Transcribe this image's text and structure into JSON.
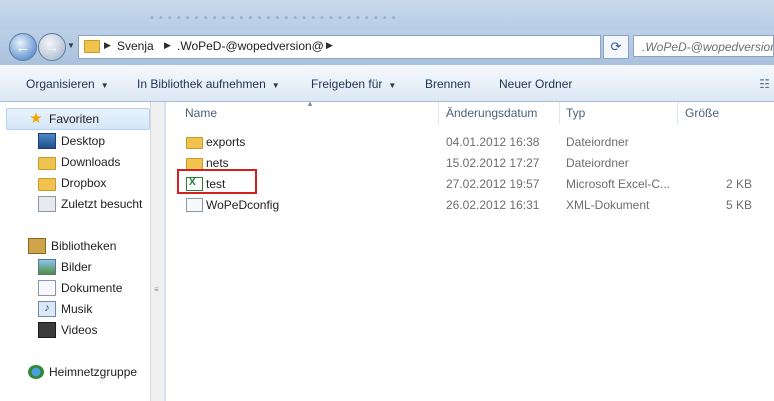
{
  "address": {
    "crumbs": [
      "Svenja",
      ".WoPeD-@wopedversion@"
    ],
    "search_text": ".WoPeD-@wopedversion@"
  },
  "toolbar": {
    "organise": "Organisieren",
    "include_library": "In Bibliothek aufnehmen",
    "share": "Freigeben für",
    "burn": "Brennen",
    "new_folder": "Neuer Ordner"
  },
  "nav": {
    "favorites": "Favoriten",
    "desktop": "Desktop",
    "downloads": "Downloads",
    "dropbox": "Dropbox",
    "recent": "Zuletzt besucht",
    "libraries": "Bibliotheken",
    "pictures": "Bilder",
    "documents": "Dokumente",
    "music": "Musik",
    "videos": "Videos",
    "homegroup": "Heimnetzgruppe"
  },
  "columns": {
    "name": "Name",
    "date": "Änderungsdatum",
    "type": "Typ",
    "size": "Größe"
  },
  "files": [
    {
      "name": "exports",
      "date": "04.01.2012 16:38",
      "type": "Dateiordner",
      "size": "",
      "icon": "folder-icon"
    },
    {
      "name": "nets",
      "date": "15.02.2012 17:27",
      "type": "Dateiordner",
      "size": "",
      "icon": "folder-icon"
    },
    {
      "name": "test",
      "date": "27.02.2012 19:57",
      "type": "Microsoft Excel-C...",
      "size": "2 KB",
      "icon": "excel-file-icon"
    },
    {
      "name": "WoPeDconfig",
      "date": "26.02.2012 16:31",
      "type": "XML-Dokument",
      "size": "5 KB",
      "icon": "xml-file-icon"
    }
  ],
  "colors": {
    "highlight_box": "#d02020",
    "window_chrome": "#b7cde4"
  }
}
